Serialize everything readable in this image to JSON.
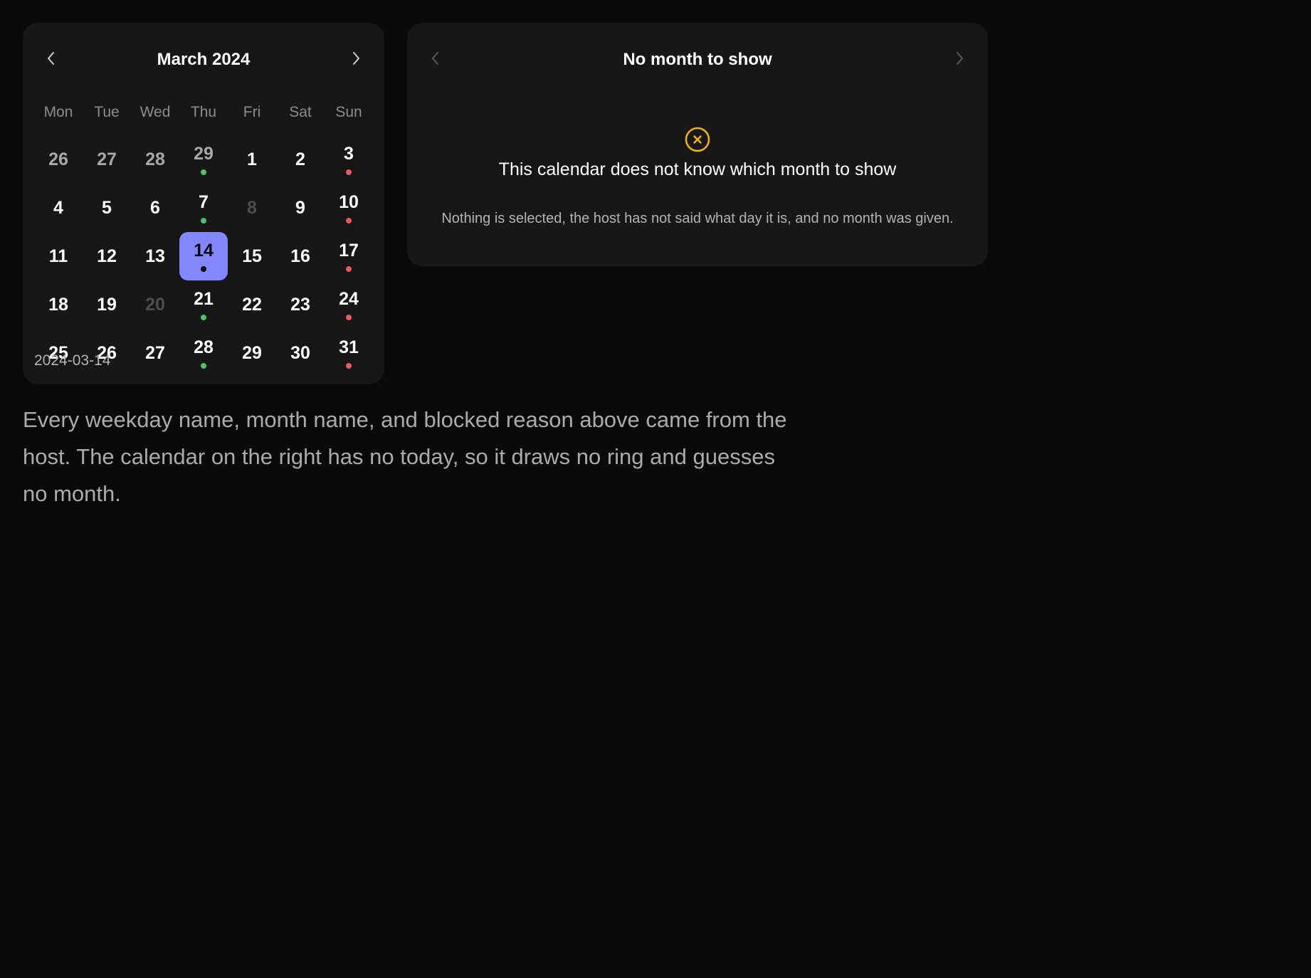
{
  "left_calendar": {
    "title": "March 2024",
    "prev_icon": "chevron-left-icon",
    "next_icon": "chevron-right-icon",
    "weekdays": [
      "Mon",
      "Tue",
      "Wed",
      "Thu",
      "Fri",
      "Sat",
      "Sun"
    ],
    "days": [
      {
        "n": "26",
        "state": "outside"
      },
      {
        "n": "27",
        "state": "outside"
      },
      {
        "n": "28",
        "state": "outside"
      },
      {
        "n": "29",
        "state": "outside",
        "dot": "#4cc46b"
      },
      {
        "n": "1"
      },
      {
        "n": "2"
      },
      {
        "n": "3",
        "dot": "#ef5a5a"
      },
      {
        "n": "4"
      },
      {
        "n": "5"
      },
      {
        "n": "6"
      },
      {
        "n": "7",
        "dot": "#4cc46b"
      },
      {
        "n": "8",
        "state": "disabled"
      },
      {
        "n": "9"
      },
      {
        "n": "10",
        "dot": "#ef5a5a"
      },
      {
        "n": "11"
      },
      {
        "n": "12"
      },
      {
        "n": "13"
      },
      {
        "n": "14",
        "state": "selected",
        "dot": "#0a0a0a"
      },
      {
        "n": "15"
      },
      {
        "n": "16"
      },
      {
        "n": "17",
        "dot": "#ef5a5a"
      },
      {
        "n": "18"
      },
      {
        "n": "19"
      },
      {
        "n": "20",
        "state": "disabled"
      },
      {
        "n": "21",
        "dot": "#4cc46b"
      },
      {
        "n": "22"
      },
      {
        "n": "23"
      },
      {
        "n": "24",
        "dot": "#ef5a5a"
      },
      {
        "n": "25"
      },
      {
        "n": "26"
      },
      {
        "n": "27"
      },
      {
        "n": "28",
        "dot": "#4cc46b"
      },
      {
        "n": "29"
      },
      {
        "n": "30"
      },
      {
        "n": "31",
        "dot": "#ef5a5a"
      }
    ],
    "selected_value": "2024-03-14"
  },
  "right_calendar": {
    "title": "No month to show",
    "prev_icon": "chevron-left-icon",
    "next_icon": "chevron-right-icon",
    "empty_icon": "x-circle-icon",
    "empty_title": "This calendar does not know which month to show",
    "empty_body": "Nothing is selected, the host has not said what day it is, and no month was given."
  },
  "caption": "Every weekday name, month name, and blocked reason above came from the host. The calendar on the right has no today, so it draws no ring and guesses no month.",
  "colors": {
    "background": "#0a0a0a",
    "panel": "#171717",
    "selected": "#8286ff",
    "dot_green": "#4cc46b",
    "dot_red": "#ef5a5a",
    "warning": "#f5b301"
  }
}
